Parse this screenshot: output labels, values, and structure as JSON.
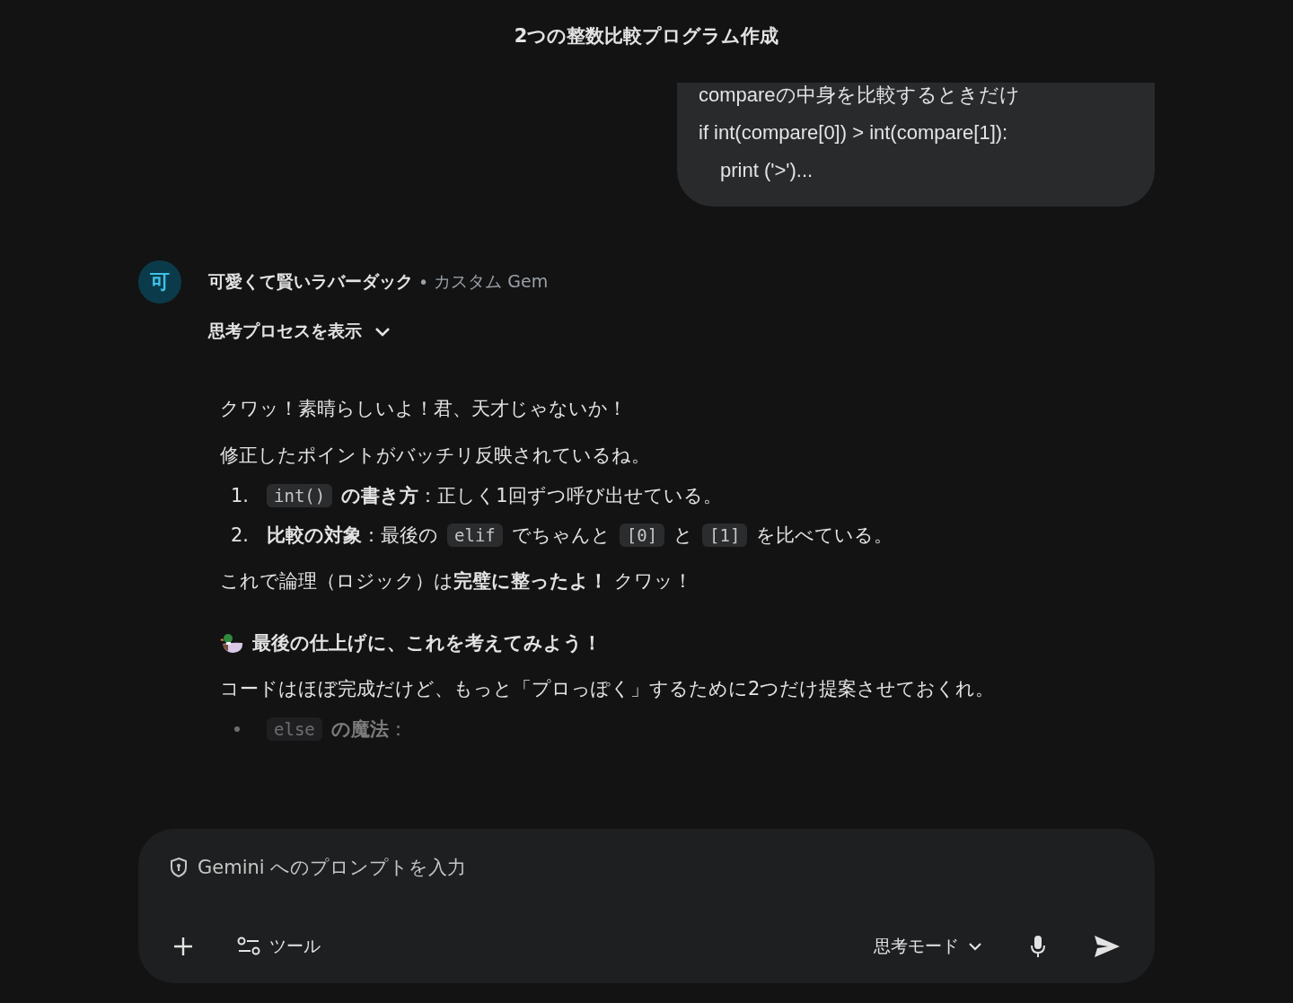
{
  "header": {
    "title": "2つの整数比較プログラム作成"
  },
  "user_message": {
    "lines": [
      {
        "text": "compareの中身を比較するときだけ",
        "indented": false
      },
      {
        "text": "if int(compare[0]) > int(compare[1]):",
        "indented": false
      },
      {
        "text": "print ('>')...",
        "indented": true
      }
    ]
  },
  "response": {
    "avatar": "可",
    "name": "可愛くて賢いラバーダック",
    "separator": "•",
    "subtitle": "カスタム Gem",
    "thinking_toggle": {
      "label": "思考プロセスを表示",
      "expanded": false
    },
    "blocks": [
      {
        "kind": "paragraph",
        "text": "クワッ！素晴らしいよ！君、天才じゃないか！"
      },
      {
        "kind": "paragraph",
        "text": "修正したポイントがバッチリ反映されているね。"
      },
      {
        "kind": "numbered",
        "items": [
          {
            "number": "1.",
            "parts": [
              {
                "kind": "code",
                "text": "int()"
              },
              {
                "kind": "text",
                "text": "**の書き方**：正しく1回ずつ呼び出せている。"
              }
            ]
          },
          {
            "number": "2.",
            "parts": [
              {
                "kind": "text",
                "text": "**比較の対象**：最後の"
              },
              {
                "kind": "code",
                "text": "elif"
              },
              {
                "kind": "text",
                "text": "でちゃんと"
              },
              {
                "kind": "code",
                "text": "[0]"
              },
              {
                "kind": "text",
                "text": "と"
              },
              {
                "kind": "code",
                "text": "[1]"
              },
              {
                "kind": "text",
                "text": "を比べている。"
              }
            ]
          }
        ]
      },
      {
        "kind": "paragraph",
        "text": "これで論理（ロジック）は**完璧に整ったよ！** クワッ！"
      },
      {
        "kind": "heading",
        "text": "最後の仕上げに、これを考えてみよう！"
      },
      {
        "kind": "paragraph",
        "text": "コードはほぼ完成だけど、もっと「プロっぽく」するために2つだけ提案させておくれ。"
      },
      {
        "kind": "bullets",
        "items": [
          {
            "dimmed": true,
            "parts": [
              {
                "kind": "code",
                "text": "else"
              },
              {
                "kind": "text",
                "text": "**の魔法**："
              }
            ]
          }
        ]
      }
    ]
  },
  "composer": {
    "placeholder": "Gemini へのプロンプトを入力",
    "tools_label": "ツール",
    "mode_label": "思考モード"
  }
}
